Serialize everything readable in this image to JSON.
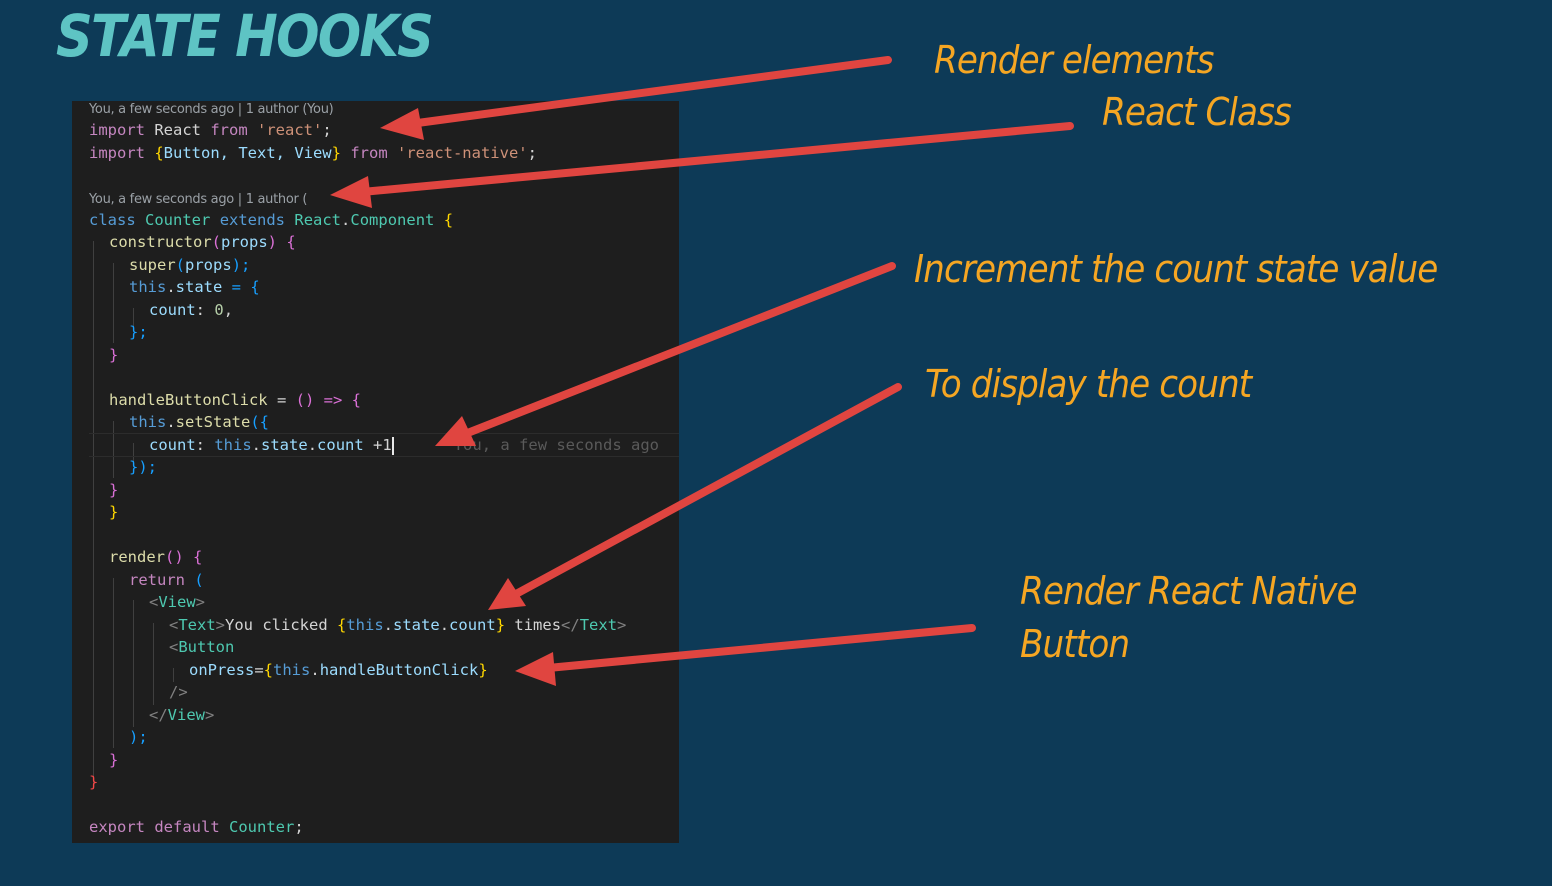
{
  "title": "STATE HOOKS",
  "blame": {
    "line1": "You, a few seconds ago | 1 author (You)",
    "line2": "You, a few seconds ago | 1 author ("
  },
  "code": {
    "l1": [
      "import",
      " React ",
      "from",
      " 'react'",
      ";"
    ],
    "l2": [
      "import",
      " {",
      "Button, Text, View",
      "} ",
      "from",
      " 'react-native'",
      ";"
    ],
    "l3": [
      "class",
      " ",
      "Counter",
      " ",
      "extends",
      " ",
      "React",
      ".",
      "Component",
      " {"
    ],
    "l4": [
      "constructor",
      "(",
      "props",
      ") {"
    ],
    "l5": [
      "super",
      "(",
      "props",
      ");"
    ],
    "l6": [
      "this",
      ".",
      "state",
      " = {"
    ],
    "l7": [
      "count",
      ": ",
      "0",
      ","
    ],
    "l8": "};",
    "l9": "}",
    "l10": [
      "handleButtonClick",
      " = ",
      "()",
      " => {"
    ],
    "l11": [
      "this",
      ".",
      "setState",
      "({"
    ],
    "l12": [
      "count",
      ": ",
      "this",
      ".",
      "state",
      ".",
      "count",
      " +1"
    ],
    "l12_ghost": "You, a few seconds ago",
    "l13": "});",
    "l14": "}",
    "l15": "}",
    "l16": [
      "render",
      "() {"
    ],
    "l17": [
      "return",
      " ("
    ],
    "l18": [
      "<",
      "View",
      ">"
    ],
    "l19": [
      "<",
      "Text",
      ">",
      "You clicked ",
      "{",
      "this",
      ".",
      "state",
      ".",
      "count",
      "}",
      " times",
      "</",
      "Text",
      ">"
    ],
    "l20": [
      "<",
      "Button"
    ],
    "l21": [
      "onPress",
      "=",
      "{",
      "this",
      ".",
      "handleButtonClick",
      "}"
    ],
    "l22": "/>",
    "l23": [
      "</",
      "View",
      ">"
    ],
    "l24": ");",
    "l25": "}",
    "l26": "}",
    "l27": [
      "export",
      " ",
      "default",
      " ",
      "Counter",
      ";"
    ]
  },
  "annotations": {
    "render_elements": "Render elements",
    "react_class": "React Class",
    "increment": "Increment the count state value",
    "display_count": "To display the count",
    "render_button_1": "Render React Native",
    "render_button_2": "Button"
  },
  "colors": {
    "background": "#0d3a57",
    "title": "#5ec4c4",
    "annotation": "#f5a623",
    "arrow": "#e04540",
    "editor_bg": "#1e1e1e"
  }
}
